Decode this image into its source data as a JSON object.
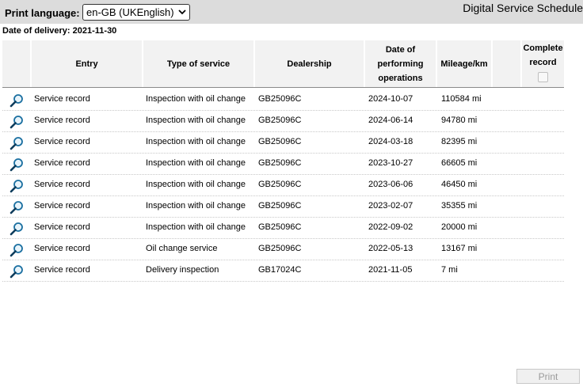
{
  "header": {
    "print_language_label": "Print language:",
    "print_language_value": "en-GB (UKEnglish)",
    "app_title": "Digital Service Schedule"
  },
  "date_of_delivery": "Date of delivery: 2021-11-30",
  "table": {
    "columns": {
      "entry": "Entry",
      "type_of_service": "Type of service",
      "dealership": "Dealership",
      "date_line1": "Date of",
      "date_line2": "performing",
      "date_line3": "operations",
      "mileage": "Mileage/km",
      "complete_line1": "Complete",
      "complete_line2": "record"
    },
    "rows": [
      {
        "entry": "Service record",
        "type": "Inspection with oil change",
        "dealership": "GB25096C",
        "date": "2024-10-07",
        "mileage": "110584 mi"
      },
      {
        "entry": "Service record",
        "type": "Inspection with oil change",
        "dealership": "GB25096C",
        "date": "2024-06-14",
        "mileage": "94780 mi"
      },
      {
        "entry": "Service record",
        "type": "Inspection with oil change",
        "dealership": "GB25096C",
        "date": "2024-03-18",
        "mileage": "82395 mi"
      },
      {
        "entry": "Service record",
        "type": "Inspection with oil change",
        "dealership": "GB25096C",
        "date": "2023-10-27",
        "mileage": "66605 mi"
      },
      {
        "entry": "Service record",
        "type": "Inspection with oil change",
        "dealership": "GB25096C",
        "date": "2023-06-06",
        "mileage": "46450 mi"
      },
      {
        "entry": "Service record",
        "type": "Inspection with oil change",
        "dealership": "GB25096C",
        "date": "2023-02-07",
        "mileage": "35355 mi"
      },
      {
        "entry": "Service record",
        "type": "Inspection with oil change",
        "dealership": "GB25096C",
        "date": "2022-09-02",
        "mileage": "20000 mi"
      },
      {
        "entry": "Service record",
        "type": "Oil change service",
        "dealership": "GB25096C",
        "date": "2022-05-13",
        "mileage": "13167 mi"
      },
      {
        "entry": "Service record",
        "type": "Delivery inspection",
        "dealership": "GB17024C",
        "date": "2021-11-05",
        "mileage": "7 mi"
      }
    ]
  },
  "footer": {
    "print_label": "Print"
  },
  "icons": {
    "row_view": "magnifier-icon",
    "select": "chevron-down-icon"
  }
}
